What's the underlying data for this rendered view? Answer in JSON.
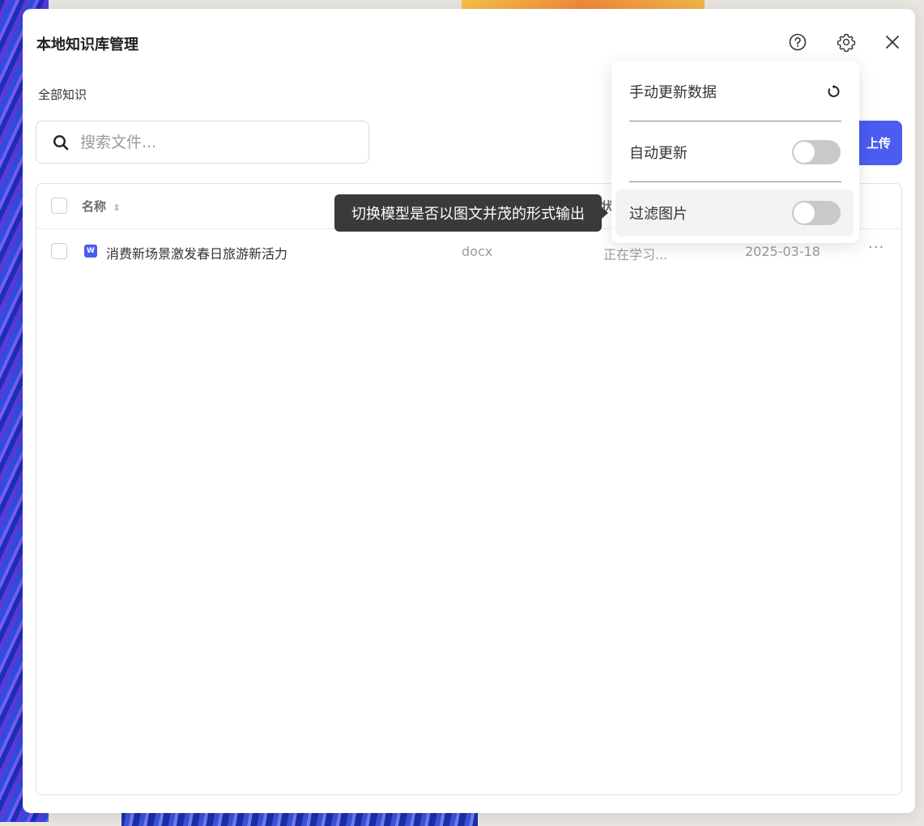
{
  "window": {
    "title": "本地知识库管理",
    "icons": {
      "help": "help-icon",
      "settings": "gear-icon",
      "close": "close-icon"
    }
  },
  "breadcrumb": "全部知识",
  "search": {
    "placeholder": "搜索文件...",
    "value": ""
  },
  "upload_button": {
    "label": "上传"
  },
  "table": {
    "columns": {
      "name": "名称",
      "status_fragment": "状"
    },
    "rows": [
      {
        "icon_letter": "W",
        "name": "消费新场景激发春日旅游新活力",
        "type": "docx",
        "status": "正在学习...",
        "date": "2025-03-18",
        "more": "···"
      }
    ]
  },
  "tooltip": {
    "text": "切换模型是否以图文并茂的形式输出"
  },
  "settings_menu": {
    "items": [
      {
        "label": "手动更新数据",
        "control": "refresh-icon"
      },
      {
        "label": "自动更新",
        "control": "toggle",
        "on": false
      },
      {
        "label": "过滤图片",
        "control": "toggle",
        "on": false
      }
    ]
  },
  "colors": {
    "accent": "#4b5cf0",
    "tooltip_bg": "#3a3a3c",
    "toggle_off": "#c9c9cc"
  }
}
